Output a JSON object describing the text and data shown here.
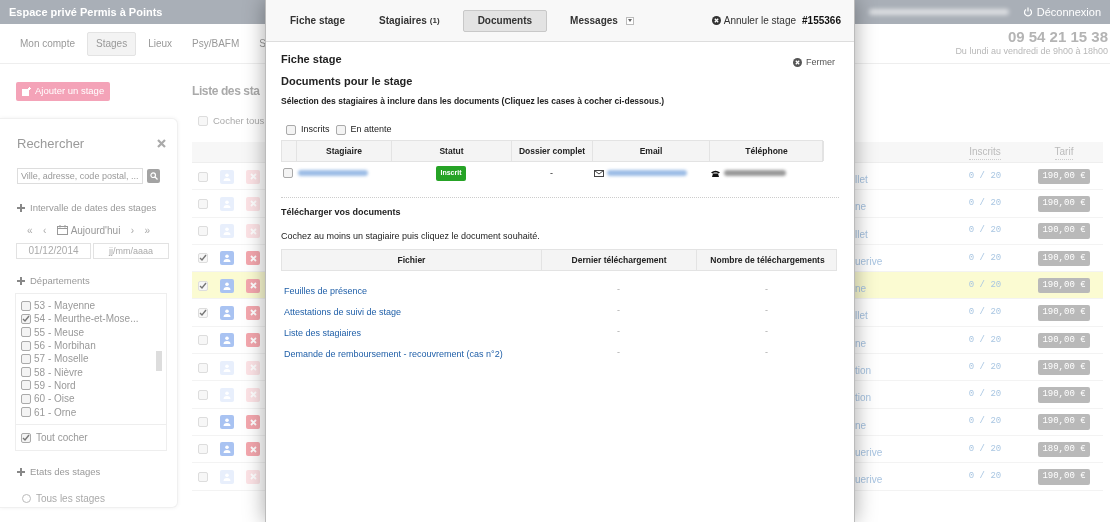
{
  "top_bar": {
    "title": "Espace privé Permis à Points",
    "logout": "Déconnexion"
  },
  "nav": {
    "tabs": [
      {
        "label": "Mon compte",
        "selected": false
      },
      {
        "label": "Stages",
        "selected": true
      },
      {
        "label": "Lieux",
        "selected": false
      },
      {
        "label": "Psy/BAFM",
        "selected": false
      },
      {
        "label": "S",
        "selected": false
      }
    ],
    "phone": "09 54 21 15 38",
    "hours": "Du lundi au vendredi de 9h00 à 18h00"
  },
  "sidebar": {
    "add_button": "Ajouter un stage",
    "search_title": "Rechercher",
    "search_placeholder": "Ville, adresse, code postal, ...",
    "dates": {
      "title": "Intervalle de dates des stages",
      "nav": [
        "«",
        "‹",
        "Aujourd'hui",
        "›",
        "»"
      ],
      "start_value": "01/12/2014",
      "end_placeholder": "jj/mm/aaaa"
    },
    "departments": {
      "title": "Départements",
      "items": [
        {
          "label": "53 - Mayenne",
          "checked": false
        },
        {
          "label": "54 - Meurthe-et-Mose...",
          "checked": true
        },
        {
          "label": "55 - Meuse",
          "checked": false
        },
        {
          "label": "56 - Morbihan",
          "checked": false
        },
        {
          "label": "57 - Moselle",
          "checked": false
        },
        {
          "label": "58 - Nièvre",
          "checked": false
        },
        {
          "label": "59 - Nord",
          "checked": false
        },
        {
          "label": "60 - Oise",
          "checked": false
        },
        {
          "label": "61 - Orne",
          "checked": false
        }
      ],
      "check_all": {
        "label": "Tout cocher",
        "checked": true
      }
    },
    "states": {
      "title": "Etats des stages",
      "option": "Tous les stages",
      "checked": false
    }
  },
  "list": {
    "title": "Liste des sta",
    "check_all": {
      "label": "Cocher tous",
      "checked": false
    },
    "columns": [
      "Inscrits",
      "Tarif"
    ],
    "rows": [
      {
        "checked": false,
        "highlighted": false,
        "dimmed": true,
        "place": "llet",
        "inscrits": "0 / 20",
        "price": "190,00 €"
      },
      {
        "checked": false,
        "highlighted": false,
        "dimmed": true,
        "place": "ne",
        "inscrits": "0 / 20",
        "price": "190,00 €"
      },
      {
        "checked": false,
        "highlighted": false,
        "dimmed": true,
        "place": "llet",
        "inscrits": "0 / 20",
        "price": "190,00 €"
      },
      {
        "checked": true,
        "highlighted": false,
        "dimmed": false,
        "place": "uerive",
        "inscrits": "0 / 20",
        "price": "190,00 €"
      },
      {
        "checked": true,
        "highlighted": true,
        "dimmed": false,
        "place": "ne",
        "inscrits": "0 / 20",
        "price": "190,00 €"
      },
      {
        "checked": true,
        "highlighted": false,
        "dimmed": false,
        "place": "llet",
        "inscrits": "0 / 20",
        "price": "190,00 €"
      },
      {
        "checked": false,
        "highlighted": false,
        "dimmed": false,
        "place": "ne",
        "inscrits": "0 / 20",
        "price": "190,00 €"
      },
      {
        "checked": false,
        "highlighted": false,
        "dimmed": true,
        "place": "tion",
        "inscrits": "0 / 20",
        "price": "190,00 €"
      },
      {
        "checked": false,
        "highlighted": false,
        "dimmed": true,
        "place": "tion",
        "inscrits": "0 / 20",
        "price": "190,00 €"
      },
      {
        "checked": false,
        "highlighted": false,
        "dimmed": false,
        "place": "ne",
        "inscrits": "0 / 20",
        "price": "190,00 €"
      },
      {
        "checked": false,
        "highlighted": false,
        "dimmed": false,
        "place": "uerive",
        "inscrits": "0 / 20",
        "price": "189,00 €"
      },
      {
        "checked": false,
        "highlighted": false,
        "dimmed": true,
        "place": "uerive",
        "inscrits": "0 / 20",
        "price": "190,00 €"
      }
    ]
  },
  "modal": {
    "tabs": [
      {
        "label": "Fiche stage",
        "selected": false,
        "dropdown": false
      },
      {
        "label": "Stagiaires",
        "count": "(1)",
        "selected": false,
        "dropdown": false
      },
      {
        "label": "Documents",
        "selected": true,
        "dropdown": false
      },
      {
        "label": "Messages",
        "selected": false,
        "dropdown": true
      }
    ],
    "cancel": "Annuler le stage",
    "stage_number": "#155366",
    "close": "Fermer",
    "section": "Fiche stage",
    "title": "Documents pour le stage",
    "instruction": "Sélection des stagiaires à inclure dans les documents (Cliquez les cases à cocher ci-dessous.)",
    "filters": [
      {
        "label": "Inscrits",
        "checked": false
      },
      {
        "label": "En attente",
        "checked": false
      }
    ],
    "trainees": {
      "columns": [
        "Stagiaire",
        "Statut",
        "Dossier complet",
        "Email",
        "Téléphone"
      ],
      "rows": [
        {
          "checked": false,
          "status": "Inscrit",
          "dossier": "-"
        }
      ]
    },
    "download_title": "Télécharger vos documents",
    "download_hint": "Cochez au moins un stagiaire puis cliquez le document souhaité.",
    "files": {
      "columns": [
        "Fichier",
        "Dernier téléchargement",
        "Nombre de téléchargements"
      ],
      "rows": [
        {
          "name": "Feuilles de présence",
          "last": "-",
          "count": "-"
        },
        {
          "name": "Attestations de suivi de stage",
          "last": "-",
          "count": "-"
        },
        {
          "name": "Liste des stagiaires",
          "last": "-",
          "count": "-"
        },
        {
          "name": "Demande de remboursement - recouvrement (cas n°2)",
          "last": "-",
          "count": "-"
        }
      ]
    }
  }
}
